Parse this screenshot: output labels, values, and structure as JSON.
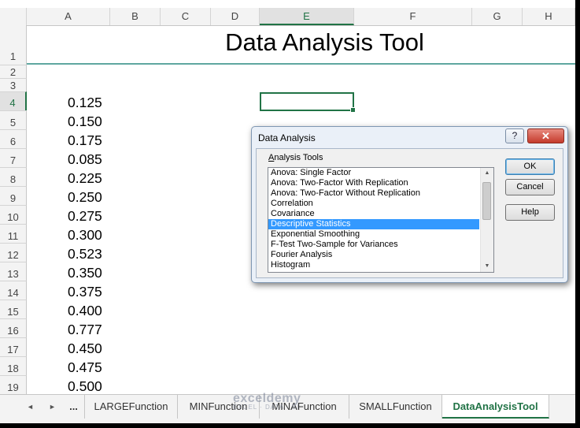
{
  "columns": [
    "A",
    "B",
    "C",
    "D",
    "E",
    "F",
    "G",
    "H"
  ],
  "selected_column": "E",
  "rows": [
    "1",
    "2",
    "3",
    "4",
    "5",
    "6",
    "7",
    "8",
    "9",
    "10",
    "11",
    "12",
    "13",
    "14",
    "15",
    "16",
    "17",
    "18",
    "19"
  ],
  "selected_row": "4",
  "title": "Data Analysis Tool",
  "values": [
    "0.125",
    "0.150",
    "0.175",
    "0.085",
    "0.225",
    "0.250",
    "0.275",
    "0.300",
    "0.523",
    "0.350",
    "0.375",
    "0.400",
    "0.777",
    "0.450",
    "0.475",
    "0.500"
  ],
  "dialog": {
    "title": "Data Analysis",
    "help_glyph": "?",
    "close_glyph": "✕",
    "group_label_first": "A",
    "group_label_rest": "nalysis Tools",
    "items": [
      "Anova: Single Factor",
      "Anova: Two-Factor With Replication",
      "Anova: Two-Factor Without Replication",
      "Correlation",
      "Covariance",
      "Descriptive Statistics",
      "Exponential Smoothing",
      "F-Test Two-Sample for Variances",
      "Fourier Analysis",
      "Histogram"
    ],
    "selected_item": "Descriptive Statistics",
    "ok_label": "OK",
    "cancel_label": "Cancel",
    "help_label": "Help"
  },
  "tabs": {
    "prev": "◄",
    "next": "►",
    "more": "...",
    "sheets": [
      "LARGEFunction",
      "MINFunction",
      "MINAFunction",
      "SMALLFunction",
      "DataAnalysisTool"
    ],
    "active": "DataAnalysisTool"
  },
  "watermark": {
    "name": "exceldemy",
    "tagline": "EXCEL · DATA · BI"
  }
}
